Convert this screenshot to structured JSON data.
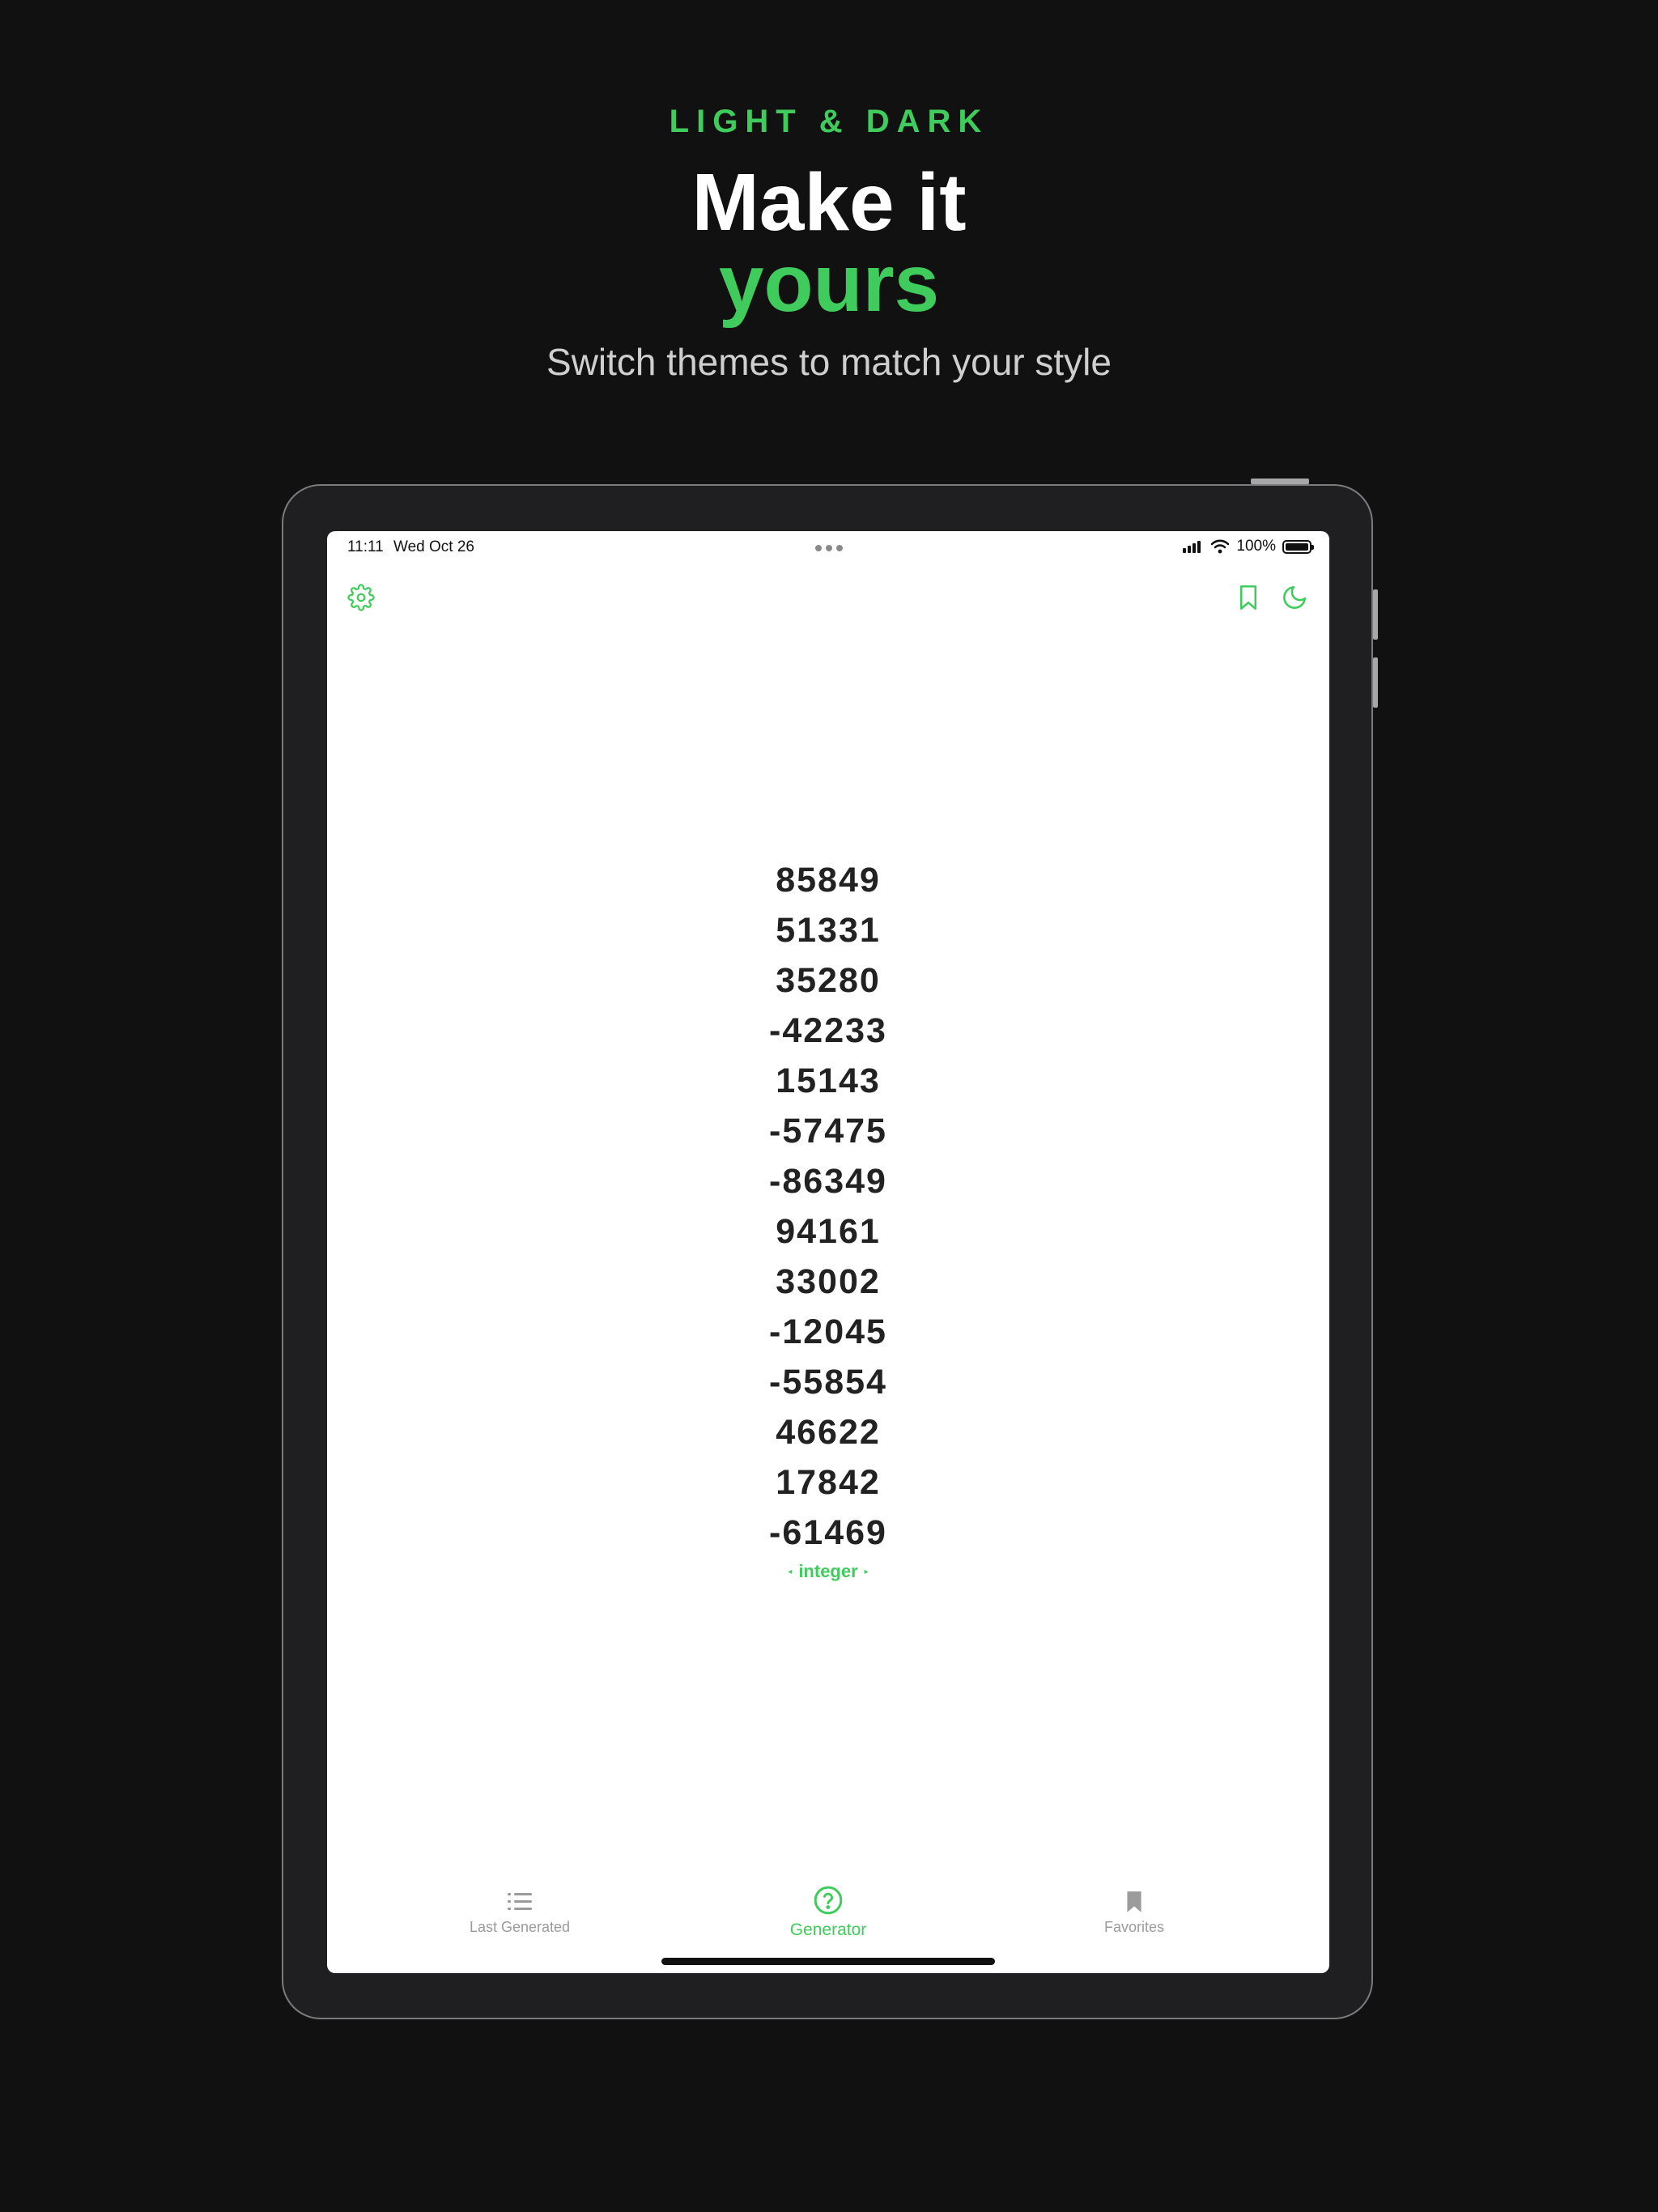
{
  "promo": {
    "eyebrow": "LIGHT & DARK",
    "headline": "Make it",
    "headline_accent": "yours",
    "subhead": "Switch themes to match your style"
  },
  "status_bar": {
    "time": "11:11",
    "date": "Wed Oct 26",
    "battery": "100%"
  },
  "toolbar": {
    "settings_icon": "gear-icon",
    "bookmark_icon": "bookmark-icon",
    "theme_icon": "moon-icon"
  },
  "generator": {
    "numbers": [
      "85849",
      "51331",
      "35280",
      "-42233",
      "15143",
      "-57475",
      "-86349",
      "94161",
      "33002",
      "-12045",
      "-55854",
      "46622",
      "17842",
      "-61469"
    ],
    "type_label": "integer"
  },
  "tab_bar": {
    "items": [
      {
        "label": "Last Generated",
        "icon": "list-icon",
        "active": false
      },
      {
        "label": "Generator",
        "icon": "question-circle-icon",
        "active": true
      },
      {
        "label": "Favorites",
        "icon": "bookmark-filled-icon",
        "active": false
      }
    ]
  },
  "colors": {
    "accent": "#3fcc5c",
    "background": "#111111",
    "inactive_tab": "#9b9b9b"
  }
}
